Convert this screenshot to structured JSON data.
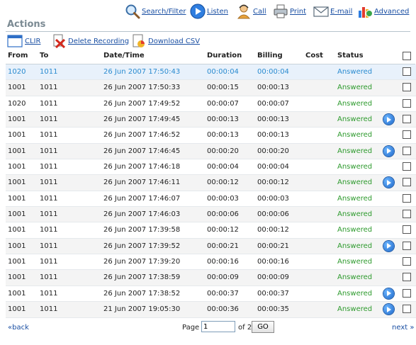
{
  "toolbar": {
    "search_filter": "Search/Filter",
    "listen": "Listen",
    "call": "Call",
    "print": "Print",
    "email": "E-mail",
    "advanced": "Advanced"
  },
  "section_title": "Actions",
  "actions": {
    "clir": "CLIR",
    "delete_recording": "Delete Recording",
    "download_csv": "Download CSV"
  },
  "table": {
    "headers": {
      "from": "From",
      "to": "To",
      "datetime": "Date/Time",
      "duration": "Duration",
      "billing": "Billing",
      "cost": "Cost",
      "status": "Status"
    },
    "rows": [
      {
        "from": "1020",
        "to": "1011",
        "datetime": "26 Jun 2007 17:50:43",
        "duration": "00:00:04",
        "billing": "00:00:04",
        "cost": "",
        "status": "Answered",
        "recording": false,
        "selected": true
      },
      {
        "from": "1001",
        "to": "1011",
        "datetime": "26 Jun 2007 17:50:33",
        "duration": "00:00:15",
        "billing": "00:00:13",
        "cost": "",
        "status": "Answered",
        "recording": false
      },
      {
        "from": "1020",
        "to": "1011",
        "datetime": "26 Jun 2007 17:49:52",
        "duration": "00:00:07",
        "billing": "00:00:07",
        "cost": "",
        "status": "Answered",
        "recording": false
      },
      {
        "from": "1001",
        "to": "1011",
        "datetime": "26 Jun 2007 17:49:45",
        "duration": "00:00:13",
        "billing": "00:00:13",
        "cost": "",
        "status": "Answered",
        "recording": true
      },
      {
        "from": "1001",
        "to": "1011",
        "datetime": "26 Jun 2007 17:46:52",
        "duration": "00:00:13",
        "billing": "00:00:13",
        "cost": "",
        "status": "Answered",
        "recording": false
      },
      {
        "from": "1001",
        "to": "1011",
        "datetime": "26 Jun 2007 17:46:45",
        "duration": "00:00:20",
        "billing": "00:00:20",
        "cost": "",
        "status": "Answered",
        "recording": true
      },
      {
        "from": "1001",
        "to": "1011",
        "datetime": "26 Jun 2007 17:46:18",
        "duration": "00:00:04",
        "billing": "00:00:04",
        "cost": "",
        "status": "Answered",
        "recording": false
      },
      {
        "from": "1001",
        "to": "1011",
        "datetime": "26 Jun 2007 17:46:11",
        "duration": "00:00:12",
        "billing": "00:00:12",
        "cost": "",
        "status": "Answered",
        "recording": true
      },
      {
        "from": "1001",
        "to": "1011",
        "datetime": "26 Jun 2007 17:46:07",
        "duration": "00:00:03",
        "billing": "00:00:03",
        "cost": "",
        "status": "Answered",
        "recording": false
      },
      {
        "from": "1001",
        "to": "1011",
        "datetime": "26 Jun 2007 17:46:03",
        "duration": "00:00:06",
        "billing": "00:00:06",
        "cost": "",
        "status": "Answered",
        "recording": false
      },
      {
        "from": "1001",
        "to": "1011",
        "datetime": "26 Jun 2007 17:39:58",
        "duration": "00:00:12",
        "billing": "00:00:12",
        "cost": "",
        "status": "Answered",
        "recording": false
      },
      {
        "from": "1001",
        "to": "1011",
        "datetime": "26 Jun 2007 17:39:52",
        "duration": "00:00:21",
        "billing": "00:00:21",
        "cost": "",
        "status": "Answered",
        "recording": true
      },
      {
        "from": "1001",
        "to": "1011",
        "datetime": "26 Jun 2007 17:39:20",
        "duration": "00:00:16",
        "billing": "00:00:16",
        "cost": "",
        "status": "Answered",
        "recording": false
      },
      {
        "from": "1001",
        "to": "1011",
        "datetime": "26 Jun 2007 17:38:59",
        "duration": "00:00:09",
        "billing": "00:00:09",
        "cost": "",
        "status": "Answered",
        "recording": false
      },
      {
        "from": "1001",
        "to": "1011",
        "datetime": "26 Jun 2007 17:38:52",
        "duration": "00:00:37",
        "billing": "00:00:37",
        "cost": "",
        "status": "Answered",
        "recording": true
      },
      {
        "from": "1001",
        "to": "1011",
        "datetime": "21 Jun 2007 19:05:30",
        "duration": "00:00:36",
        "billing": "00:00:35",
        "cost": "",
        "status": "Answered",
        "recording": true
      }
    ]
  },
  "pagination": {
    "back": "«back",
    "page_label": "Page",
    "current_page": "1",
    "of_label": "of 2",
    "go": "GO",
    "next": "next »"
  },
  "icons": {
    "search_filter": "magnifier-icon",
    "listen": "play-icon",
    "call": "person-phone-icon",
    "print": "printer-icon",
    "email": "envelope-icon",
    "advanced": "chart-icon",
    "clir": "window-icon",
    "delete_recording": "delete-x-icon",
    "download_csv": "document-chart-icon"
  },
  "colors": {
    "link": "#1a4fa3",
    "status": "#2d9a2d",
    "selected_row": "#e8f1fb",
    "selected_text": "#2a8bd0"
  }
}
